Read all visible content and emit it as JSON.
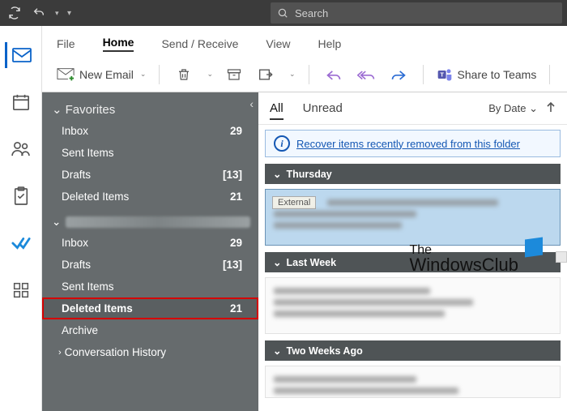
{
  "titlebar": {
    "search_placeholder": "Search"
  },
  "ribbon": {
    "tabs": {
      "file": "File",
      "home": "Home",
      "sendreceive": "Send / Receive",
      "view": "View",
      "help": "Help"
    },
    "new_email": "New Email",
    "share_teams": "Share to Teams"
  },
  "favorites": {
    "header": "Favorites",
    "items": [
      {
        "name": "Inbox",
        "count": "29"
      },
      {
        "name": "Sent Items",
        "count": ""
      },
      {
        "name": "Drafts",
        "count": "[13]"
      },
      {
        "name": "Deleted Items",
        "count": "21"
      }
    ]
  },
  "account": {
    "items": [
      {
        "name": "Inbox",
        "count": "29"
      },
      {
        "name": "Drafts",
        "count": "[13]"
      },
      {
        "name": "Sent Items",
        "count": ""
      },
      {
        "name": "Deleted Items",
        "count": "21"
      },
      {
        "name": "Archive",
        "count": ""
      }
    ],
    "conversation_history": "Conversation History"
  },
  "msglist": {
    "filters": {
      "all": "All",
      "unread": "Unread"
    },
    "sort": "By Date",
    "recover_link": "Recover items recently removed from this folder",
    "groups": {
      "g1": "Thursday",
      "g2": "Last Week",
      "g3": "Two Weeks Ago"
    },
    "external_badge": "External"
  },
  "watermark": {
    "line1": "The",
    "line2": "WindowsClub"
  }
}
